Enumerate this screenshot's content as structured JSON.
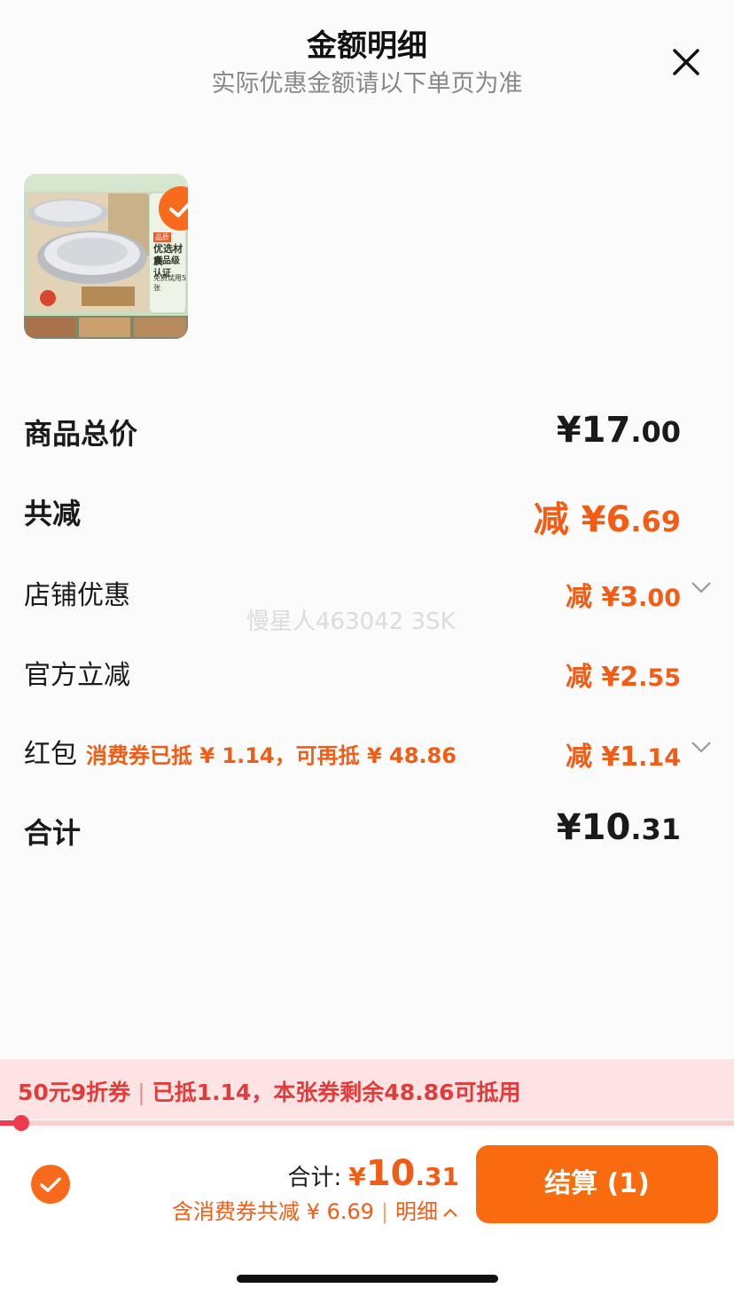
{
  "header": {
    "title": "金额明细",
    "subtitle": "实际优惠金额请以下单页为准",
    "close_icon": "close-icon"
  },
  "product": {
    "thumb_headline_1": "优选材质",
    "thumb_headline_2": "食品级认证",
    "thumb_small_1": "免费试用5张",
    "thumb_tag": "品质",
    "selected": true
  },
  "rows": {
    "total_price": {
      "label": "商品总价",
      "currency": "¥",
      "main": "17",
      "dec": ".00"
    },
    "total_discount": {
      "label": "共减",
      "prefix": "减 ¥",
      "main": "6",
      "dec": ".69"
    },
    "shop_discount": {
      "label": "店铺优惠",
      "prefix": "减 ¥",
      "main": "3",
      "dec": ".00"
    },
    "official_discount": {
      "label": "官方立减",
      "prefix": "减 ¥",
      "main": "2",
      "dec": ".55"
    },
    "red_packet": {
      "label": "红包",
      "note": "消费券已抵 ¥ 1.14，可再抵 ¥ 48.86",
      "prefix": "减 ¥",
      "main": "1",
      "dec": ".14"
    },
    "sum": {
      "label": "合计",
      "currency": "¥",
      "main": "10",
      "dec": ".31"
    }
  },
  "watermark": "慢星人463042 3SK",
  "coupon": {
    "name": "50元9折券",
    "desc": "已抵1.14，本张券剩余48.86可抵用",
    "used_fraction": 0.0287,
    "color": "#ef3a4e"
  },
  "footer": {
    "total_label": "合计:",
    "currency": "¥",
    "total_main": "10",
    "total_dec": ".31",
    "savings_text": "含消费券共减 ¥ 6.69",
    "detail_label": "明细",
    "checkout_label": "结算 (1)",
    "accent": "#fa6a0f"
  }
}
